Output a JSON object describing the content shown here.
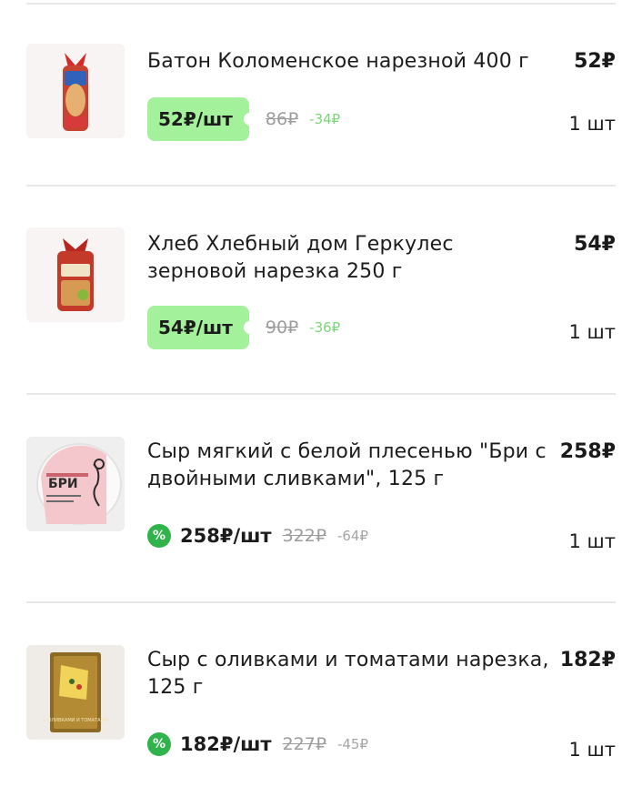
{
  "items": [
    {
      "name": "Батон Коломенское нарезной 400 г",
      "total": "52₽",
      "price": "52₽/шт",
      "old_price": "86₽",
      "discount": "-34₽",
      "qty": "1 шт",
      "image": "bread-loaf-bag"
    },
    {
      "name": "Хлеб Хлебный дом Геркулес зерновой нарезка 250 г",
      "total": "54₽",
      "price": "54₽/шт",
      "old_price": "90₽",
      "discount": "-36₽",
      "qty": "1 шт",
      "image": "bread-grain-bag"
    },
    {
      "name": "Сыр мягкий с белой плесенью \"Бри с двойными сливками\", 125 г",
      "total": "258₽",
      "price": "258₽/шт",
      "old_price": "322₽",
      "discount": "-64₽",
      "qty": "1 шт",
      "image": "brie-cheese-box",
      "package_text": "БРИ"
    },
    {
      "name": "Сыр с оливками и томатами нарезка, 125 г",
      "total": "182₽",
      "price": "182₽/шт",
      "old_price": "227₽",
      "discount": "-45₽",
      "qty": "1 шт",
      "image": "sliced-cheese-pack",
      "package_text": "С ОЛИВКАМИ И ТОМАТАМИ"
    }
  ],
  "badge_icon": "percent-icon",
  "badge_symbol": "%",
  "colors": {
    "promo_pill": "#a4f19b",
    "discount_green": "#7ed47a",
    "badge_green": "#2fb34a",
    "divider": "#e7e7e7"
  }
}
